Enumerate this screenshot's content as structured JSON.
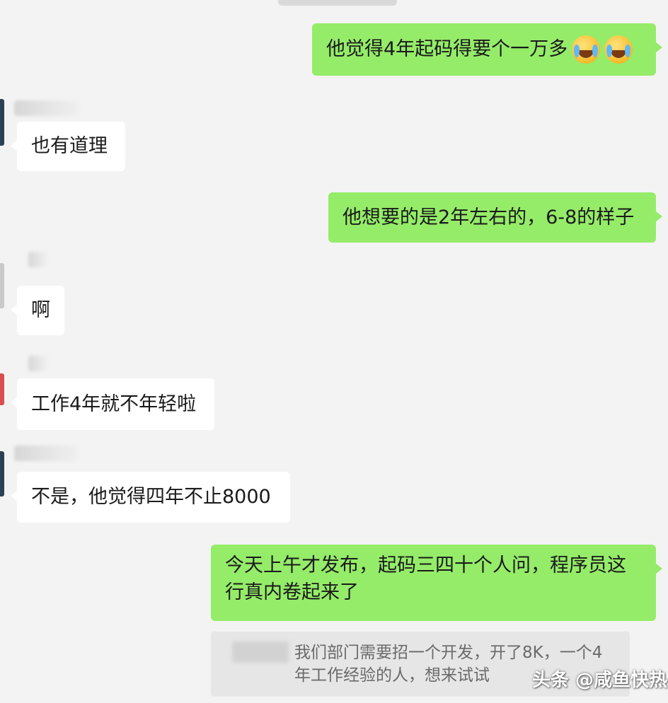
{
  "messages": [
    {
      "side": "right",
      "text": "他觉得4年起码得要个一万多"
    },
    {
      "side": "left",
      "text": "也有道理"
    },
    {
      "side": "right",
      "text": "他想要的是2年左右的，6-8的样子"
    },
    {
      "side": "left",
      "text": "啊"
    },
    {
      "side": "left",
      "text": "工作4年就不年轻啦"
    },
    {
      "side": "left",
      "text": "不是，他觉得四年不止8000"
    },
    {
      "side": "right",
      "text": "今天上午才发布，起码三四十个人问，程序员这行真内卷起来了"
    }
  ],
  "emojis": [
    "crying-laughing-emoji",
    "crying-laughing-emoji"
  ],
  "quoted_message": {
    "text": "我们部门需要招一个开发，开了8K，一个4年工作经验的人，想来试试"
  },
  "watermark": "头条 @咸鱼快热",
  "colors": {
    "background": "#f3f3f3",
    "own_bubble": "#95ec69",
    "other_bubble": "#ffffff",
    "quote_bg": "#e6e6e6"
  }
}
